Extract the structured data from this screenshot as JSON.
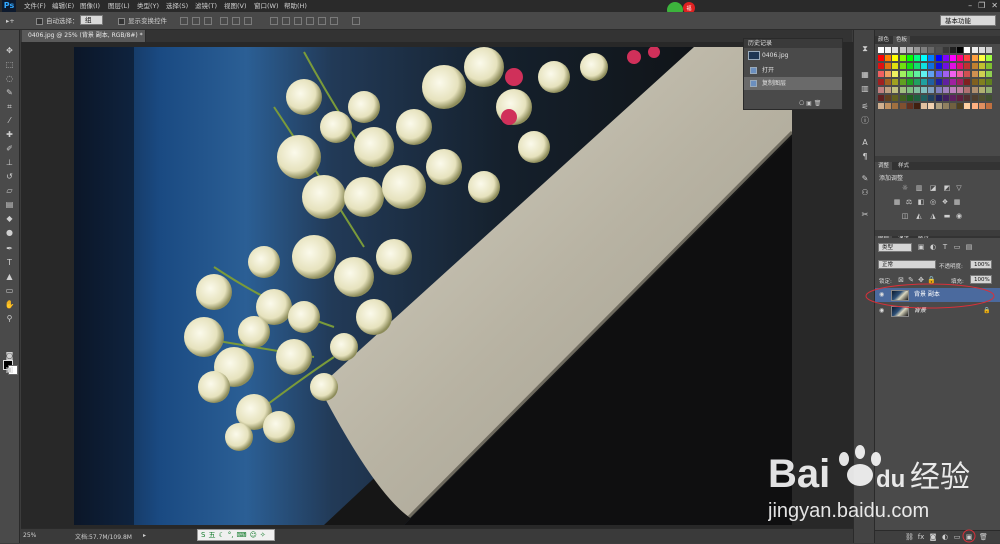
{
  "menubar": {
    "logo": "Ps",
    "items": [
      "文件(F)",
      "编辑(E)",
      "图像(I)",
      "图层(L)",
      "类型(Y)",
      "选择(S)",
      "滤镜(T)",
      "视图(V)",
      "窗口(W)",
      "帮助(H)"
    ],
    "window_controls": [
      "–",
      "❐",
      "✕"
    ]
  },
  "optionsbar": {
    "auto_select_label": "自动选择：",
    "auto_select_value": "组",
    "show_transform_label": "显示变换控件",
    "workspace": "基本功能"
  },
  "document": {
    "tab_title": "0406.jpg @ 25% (背景 副本, RGB/8#) *",
    "zoom": "25%",
    "doc_size": "文档:57.7M/109.8M"
  },
  "history": {
    "title": "历史记录",
    "snapshot": "0406.jpg",
    "steps": [
      "打开",
      "复制图层"
    ]
  },
  "swatches": {
    "tab_color": "颜色",
    "tab_swatches": "色板"
  },
  "adjustments": {
    "tab_adjust": "调整",
    "tab_styles": "样式",
    "add_label": "添加调整"
  },
  "layers": {
    "tab_layers": "图层",
    "tab_channels": "通道",
    "tab_paths": "路径",
    "kind": "类型",
    "blend_mode": "正常",
    "opacity_label": "不透明度:",
    "opacity_value": "100%",
    "lock_label": "锁定:",
    "fill_label": "填充:",
    "fill_value": "100%",
    "rows": [
      {
        "name": "背景 副本"
      },
      {
        "name": "背景"
      }
    ]
  },
  "float_logo": {
    "text": "点我加速"
  },
  "ime": {
    "text": "五"
  },
  "watermark": {
    "brand": "Bai",
    "brand2": "du",
    "product": "经验",
    "url": "jingyan.baidu.com"
  },
  "colors": {
    "accent": "#31a8ff",
    "panel": "#4a4a4a",
    "dark": "#2a2a2a",
    "selected_layer": "#4b6a9e"
  }
}
